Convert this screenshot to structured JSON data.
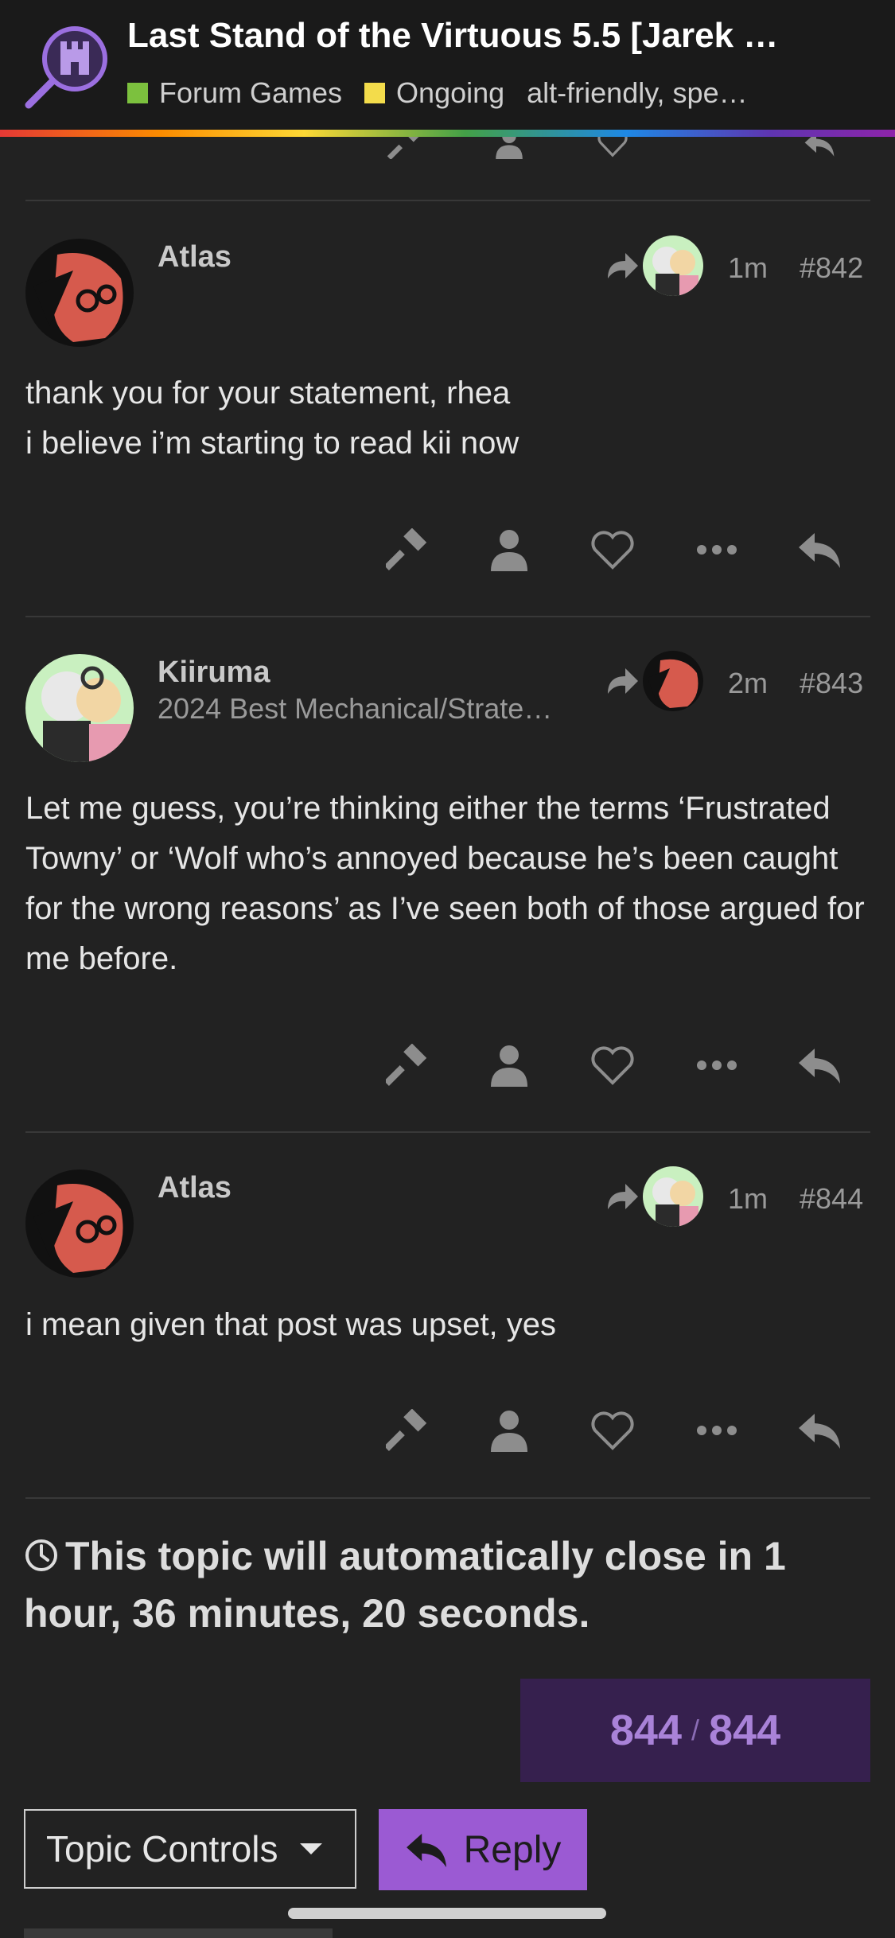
{
  "header": {
    "title": "Last Stand of the Virtuous 5.5 [Jarek …",
    "category": "Forum Games",
    "category_color": "#7cc13e",
    "status_tag": "Ongoing",
    "status_color": "#f3dc4b",
    "tags": "alt-friendly,  spe…",
    "logo_icon": "castle-magnifier-icon"
  },
  "posts": [
    {
      "username": "Atlas",
      "user_title": "",
      "reply_to_avatar": "kiiruma",
      "time": "1m",
      "number": "#842",
      "body": [
        "thank you for your statement, rhea",
        "i believe i’m starting to read kii now"
      ]
    },
    {
      "username": "Kiiruma",
      "user_title": "2024 Best Mechanical/Strate…",
      "reply_to_avatar": "atlas",
      "time": "2m",
      "number": "#843",
      "body": [
        "Let me guess, you’re thinking either the terms ‘Frustrated Towny’ or ‘Wolf who’s annoyed because he’s been caught for the wrong reasons’ as I’ve seen both of those argued for me before."
      ]
    },
    {
      "username": "Atlas",
      "user_title": "",
      "reply_to_avatar": "kiiruma",
      "time": "1m",
      "number": "#844",
      "body": [
        "i mean given that post was upset, yes"
      ]
    }
  ],
  "actions": [
    "gavel-icon",
    "user-icon",
    "heart-icon",
    "more-icon",
    "reply-icon"
  ],
  "timer": {
    "text": "This topic will automatically close in 1 hour, 36 minutes, 20 seconds."
  },
  "progress": {
    "current": "844",
    "separator": "/",
    "total": "844"
  },
  "footer": {
    "topic_controls": "Topic Controls",
    "reply": "Reply"
  },
  "colors": {
    "accent": "#9b5ad3",
    "background": "#222222"
  }
}
